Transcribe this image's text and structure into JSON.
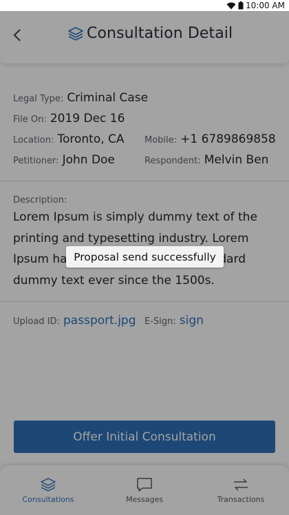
{
  "status_bar": {
    "time": "10:00 AM"
  },
  "header": {
    "title": "Consultation Detail"
  },
  "details": {
    "legal_type": {
      "label": "Legal Type:",
      "value": "Criminal Case"
    },
    "file_on": {
      "label": "File On:",
      "value": "2019 Dec 16"
    },
    "location": {
      "label": "Location:",
      "value": "Toronto, CA"
    },
    "mobile": {
      "label": "Mobile:",
      "value": "+1 6789869858"
    },
    "petitioner": {
      "label": "Petitioner:",
      "value": "John Doe"
    },
    "respondent": {
      "label": "Respondent:",
      "value": "Melvin Ben"
    }
  },
  "description": {
    "label": "Description:",
    "text": "Lorem Ipsum is simply dummy text of the printing and typesetting industry. Lorem Ipsum has been the industry's standard dummy text ever since the 1500s."
  },
  "uploads": {
    "upload_id": {
      "label": "Upload ID:",
      "value": "passport.jpg"
    },
    "esign": {
      "label": "E-Sign:",
      "value": "sign"
    }
  },
  "cta": {
    "label": "Offer Initial Consultation"
  },
  "toast": {
    "text": "Proposal send successfully"
  },
  "bottom_nav": [
    {
      "label": "Consultations",
      "icon": "layers-icon",
      "active": true
    },
    {
      "label": "Messages",
      "icon": "message-icon",
      "active": false
    },
    {
      "label": "Transactions",
      "icon": "transfer-arrows-icon",
      "active": false
    }
  ],
  "colors": {
    "accent": "#2e6fb8",
    "overlay": "rgba(0,0,0,0.36)"
  }
}
